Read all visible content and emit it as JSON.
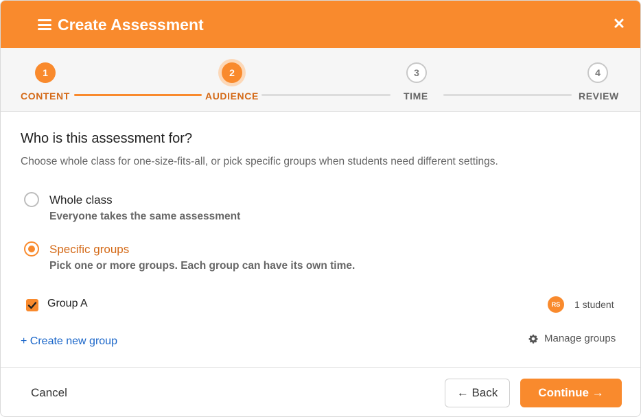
{
  "header": {
    "title": "Create Assessment",
    "menu_icon": "hamburger-menu-icon",
    "close_icon": "close-icon",
    "background_color": "#f98a2d"
  },
  "stepper": {
    "steps": [
      {
        "number": "1",
        "label": "CONTENT",
        "state": "done"
      },
      {
        "number": "2",
        "label": "AUDIENCE",
        "state": "active"
      },
      {
        "number": "3",
        "label": "TIME",
        "state": "pending"
      },
      {
        "number": "4",
        "label": "REVIEW",
        "state": "pending"
      }
    ],
    "accent_color": "#f98a2d"
  },
  "content": {
    "question": "Who is this assessment for?",
    "hint": "Choose whole class for one-size-fits-all, or pick specific groups when students need different settings.",
    "options": [
      {
        "title": "Whole class",
        "description": "Everyone takes the same assessment",
        "selected": false
      },
      {
        "title": "Specific groups",
        "description": "Pick one or more groups. Each group can have its own time.",
        "selected": true
      }
    ],
    "groups": [
      {
        "name": "Group A",
        "checked": true,
        "avatar_initials": "RS",
        "student_count": "1 student"
      }
    ],
    "create_group_link": "+ Create new group",
    "manage_groups_label": "Manage groups",
    "manage_groups_icon": "gear-icon"
  },
  "footer": {
    "cancel_label": "Cancel",
    "back_label": "← Back",
    "continue_label": "Continue →"
  }
}
